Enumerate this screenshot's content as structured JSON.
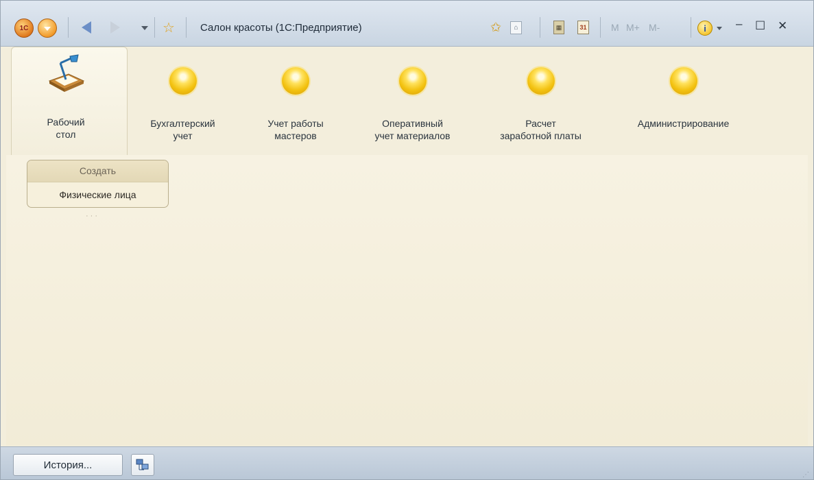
{
  "window": {
    "title": "Салон красоты  (1С:Предприятие)",
    "logo_text": "1С"
  },
  "toolbar": {
    "icons": [
      "star-favorites-icon",
      "bookmark-icon",
      "calculator-icon",
      "calendar-icon"
    ],
    "memory": [
      "M",
      "M+",
      "M-"
    ]
  },
  "sections": [
    {
      "label": "Рабочий\nстол",
      "icon": "desk-lamp-icon",
      "active": true
    },
    {
      "label": "Бухгалтерский\nучет",
      "icon": "section-orb-icon"
    },
    {
      "label": "Учет работы\nмастеров",
      "icon": "section-orb-icon"
    },
    {
      "label": "Оперативный\nучет материалов",
      "icon": "section-orb-icon"
    },
    {
      "label": "Расчет\nзаработной платы",
      "icon": "section-orb-icon"
    },
    {
      "label": "Администрирование",
      "icon": "section-orb-icon"
    }
  ],
  "create_panel": {
    "title": "Создать",
    "items": [
      "Физические лица"
    ]
  },
  "bottom": {
    "history_label": "История..."
  },
  "colors": {
    "workspace": "#f3eedc",
    "titlebar": "#c9d5e2",
    "orb": "#f3c211"
  }
}
